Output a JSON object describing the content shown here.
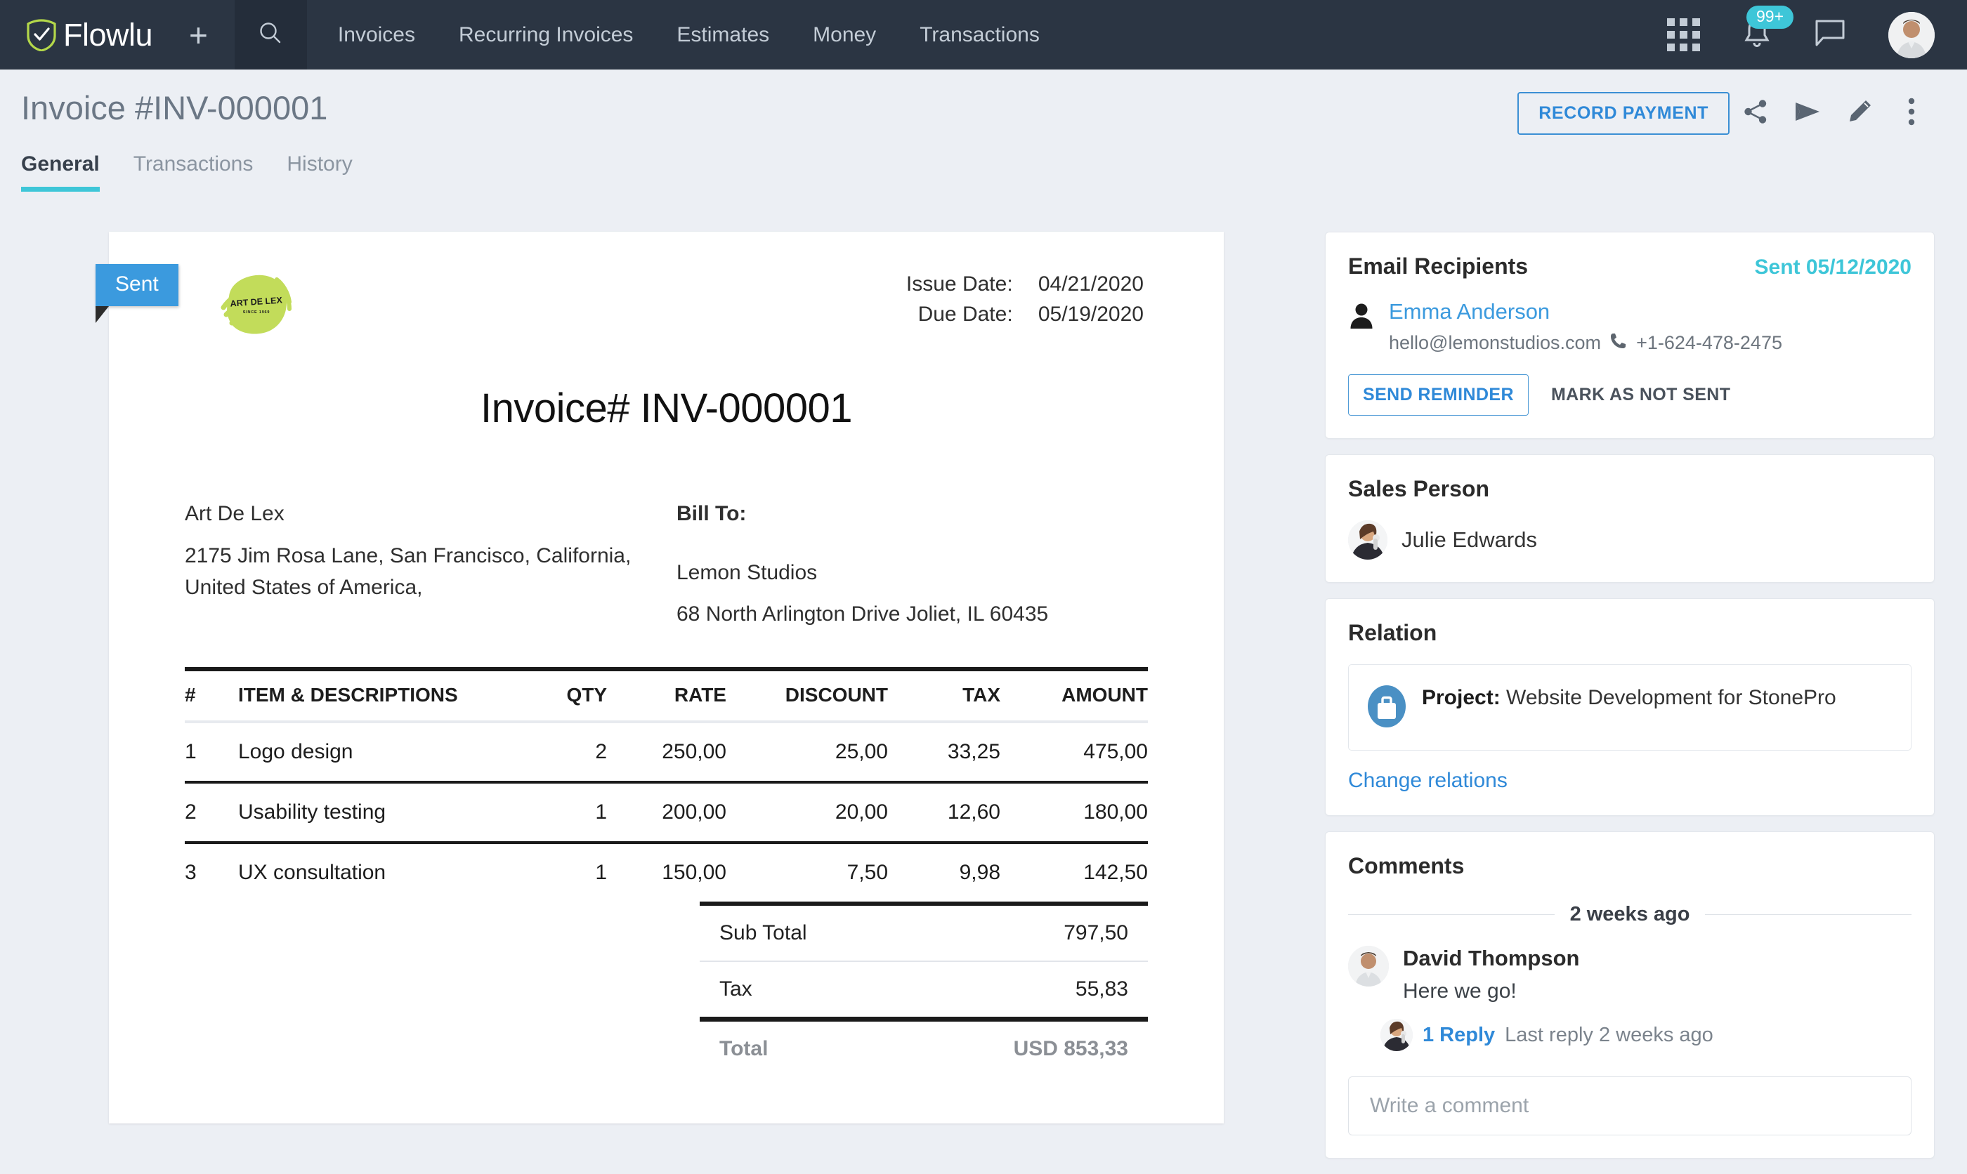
{
  "topnav": {
    "brand": "Flowlu",
    "add_label": "+",
    "search_icon": "search-icon",
    "links": [
      {
        "label": "Invoices"
      },
      {
        "label": "Recurring Invoices"
      },
      {
        "label": "Estimates"
      },
      {
        "label": "Money"
      },
      {
        "label": "Transactions"
      }
    ],
    "notification_badge": "99+",
    "accent": "#3ec6d8",
    "bg": "#2b3543"
  },
  "pagehead": {
    "title": "Invoice #INV-000001",
    "record_payment_label": "RECORD PAYMENT",
    "tabs": [
      {
        "label": "General",
        "active": true
      },
      {
        "label": "Transactions",
        "active": false
      },
      {
        "label": "History",
        "active": false
      }
    ],
    "icons": [
      "share-icon",
      "send-icon",
      "edit-icon",
      "more-vertical-icon"
    ]
  },
  "document": {
    "status_ribbon": "Sent",
    "logo": {
      "name": "Art De Lex logo",
      "text": "ART DE LEX",
      "tagline": "SINCE 1969",
      "color": "#c2dc5a"
    },
    "issue_date_label": "Issue Date:",
    "issue_date": "04/21/2020",
    "due_date_label": "Due Date:",
    "due_date": "05/19/2020",
    "invoice_heading": "Invoice# INV-000001",
    "from": {
      "name": "Art De Lex",
      "line1": "2175 Jim Rosa Lane, San Francisco, California,",
      "line2": "United States of America,"
    },
    "bill_to_label": "Bill To:",
    "bill_to": {
      "name": "Lemon Studios",
      "line1": "68 North Arlington Drive Joliet, IL 60435"
    },
    "table": {
      "headers": [
        "#",
        "ITEM & DESCRIPTIONS",
        "QTY",
        "RATE",
        "DISCOUNT",
        "TAX",
        "AMOUNT"
      ],
      "rows": [
        {
          "num": "1",
          "desc": "Logo design",
          "qty": "2",
          "rate": "250,00",
          "discount": "25,00",
          "tax": "33,25",
          "amount": "475,00"
        },
        {
          "num": "2",
          "desc": "Usability testing",
          "qty": "1",
          "rate": "200,00",
          "discount": "20,00",
          "tax": "12,60",
          "amount": "180,00"
        },
        {
          "num": "3",
          "desc": "UX consultation",
          "qty": "1",
          "rate": "150,00",
          "discount": "7,50",
          "tax": "9,98",
          "amount": "142,50"
        }
      ]
    },
    "totals": {
      "subtotal_label": "Sub Total",
      "subtotal_value": "797,50",
      "tax_label": "Tax",
      "tax_value": "55,83",
      "total_label": "Total",
      "total_value": "USD 853,33"
    }
  },
  "sidebar": {
    "email_recipients": {
      "title": "Email Recipients",
      "sent_status": "Sent 05/12/2020",
      "recipient_name": "Emma Anderson",
      "recipient_email": "hello@lemonstudios.com",
      "recipient_phone": "+1-624-478-2475",
      "send_reminder_label": "SEND REMINDER",
      "mark_not_sent_label": "MARK AS NOT SENT"
    },
    "sales_person": {
      "title": "Sales Person",
      "name": "Julie Edwards"
    },
    "relation": {
      "title": "Relation",
      "project_label": "Project:",
      "project_name": "Website Development for StonePro",
      "change_link": "Change relations"
    },
    "comments": {
      "title": "Comments",
      "date_divider": "2 weeks ago",
      "author": "David Thompson",
      "text": "Here we go!",
      "reply_count": "1 Reply",
      "reply_meta": "Last reply 2 weeks ago",
      "input_placeholder": "Write a comment"
    }
  }
}
